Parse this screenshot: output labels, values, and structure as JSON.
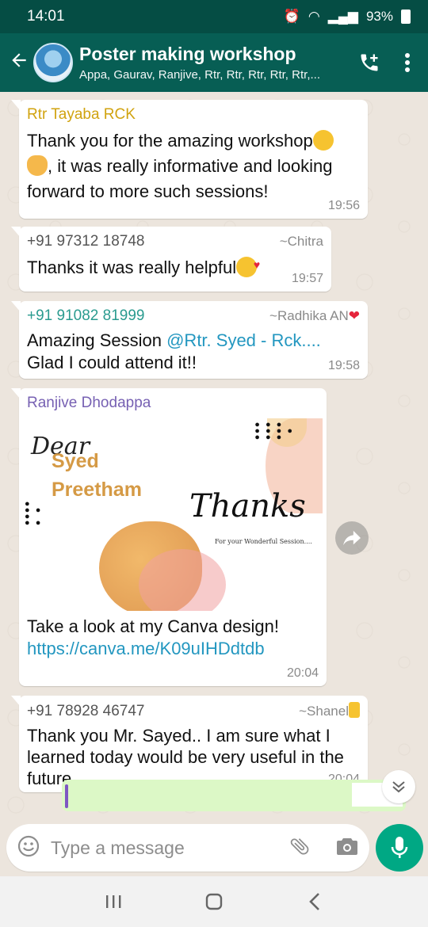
{
  "status_bar": {
    "time": "14:01",
    "battery": "93%"
  },
  "header": {
    "title": "Poster making workshop",
    "subtitle": "Appa, Gaurav, Ranjive, Rtr, Rtr, Rtr, Rtr, Rtr,..."
  },
  "messages": [
    {
      "sender": "Rtr Tayaba RCK",
      "sender_color": "#d1a30f",
      "text_1": "Thank you for the amazing workshop",
      "text_2": ", it was really informative and looking",
      "text_3": "forward to more such sessions!",
      "time": "19:56"
    },
    {
      "sender": "+91 97312 18748",
      "sender_color": "#555555",
      "alias": "~Chitra",
      "text": "Thanks it was really  helpful",
      "time": "19:57"
    },
    {
      "sender": "+91 91082 81999",
      "sender_color": "#2a9b8f",
      "alias": "~Radhika AN",
      "text_before": "Amazing Session ",
      "mention": "@Rtr. Syed - Rck....",
      "text_2": "Glad I could attend it!!",
      "time": "19:58"
    },
    {
      "sender": "Ranjive Dhodappa",
      "sender_color": "#7761b3",
      "image": {
        "dear": "Dear",
        "name_1": "Syed",
        "name_2": "Preetham",
        "thanks": "Thanks",
        "sub": "For your Wonderful Session...."
      },
      "text": "Take a look at my Canva design!",
      "link": "https://canva.me/K09uIHDdtdb",
      "time": "20:04"
    },
    {
      "sender": "+91 78928 46747",
      "sender_color": "#555555",
      "alias": "~Shanel",
      "text_1": "Thank you Mr. Sayed.. I am sure what I",
      "text_2": "learned today would be very useful in the",
      "text_3": "future",
      "time": "20:04"
    }
  ],
  "input": {
    "placeholder": "Type a message"
  },
  "colors": {
    "app_bar": "#075e54",
    "status_bar": "#054d44",
    "accent": "#00a884",
    "chat_bg": "#ece5dd",
    "link": "#2397c0"
  }
}
